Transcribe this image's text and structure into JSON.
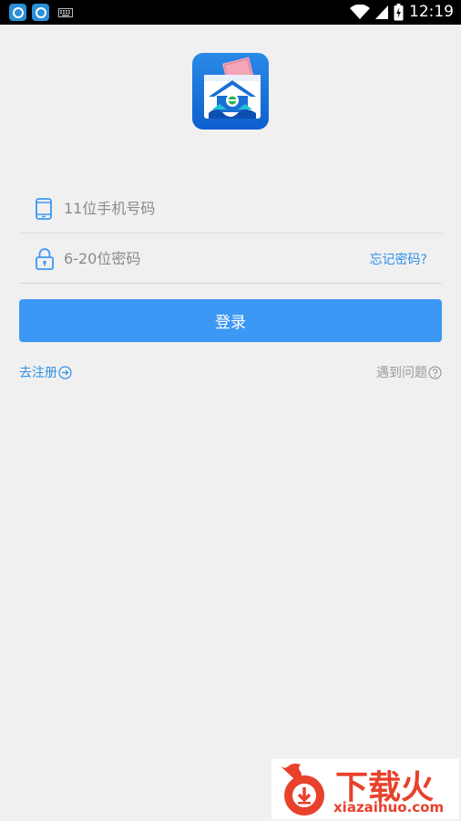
{
  "status_bar": {
    "time": "12:19",
    "battery_icon": "battery-charging-icon",
    "wifi_icon": "wifi-icon",
    "signal_icon": "signal-icon"
  },
  "login": {
    "phone_placeholder": "11位手机号码",
    "password_placeholder": "6-20位密码",
    "forgot_label": "忘记密码?",
    "login_label": "登录",
    "register_label": "去注册",
    "help_label": "遇到问题"
  },
  "watermark": {
    "title": "下载火",
    "url": "xiazaihuo.com"
  },
  "colors": {
    "accent": "#3d98f5",
    "link": "#2f8fe8",
    "background": "#f0f0f0",
    "watermark": "#e8412c"
  }
}
